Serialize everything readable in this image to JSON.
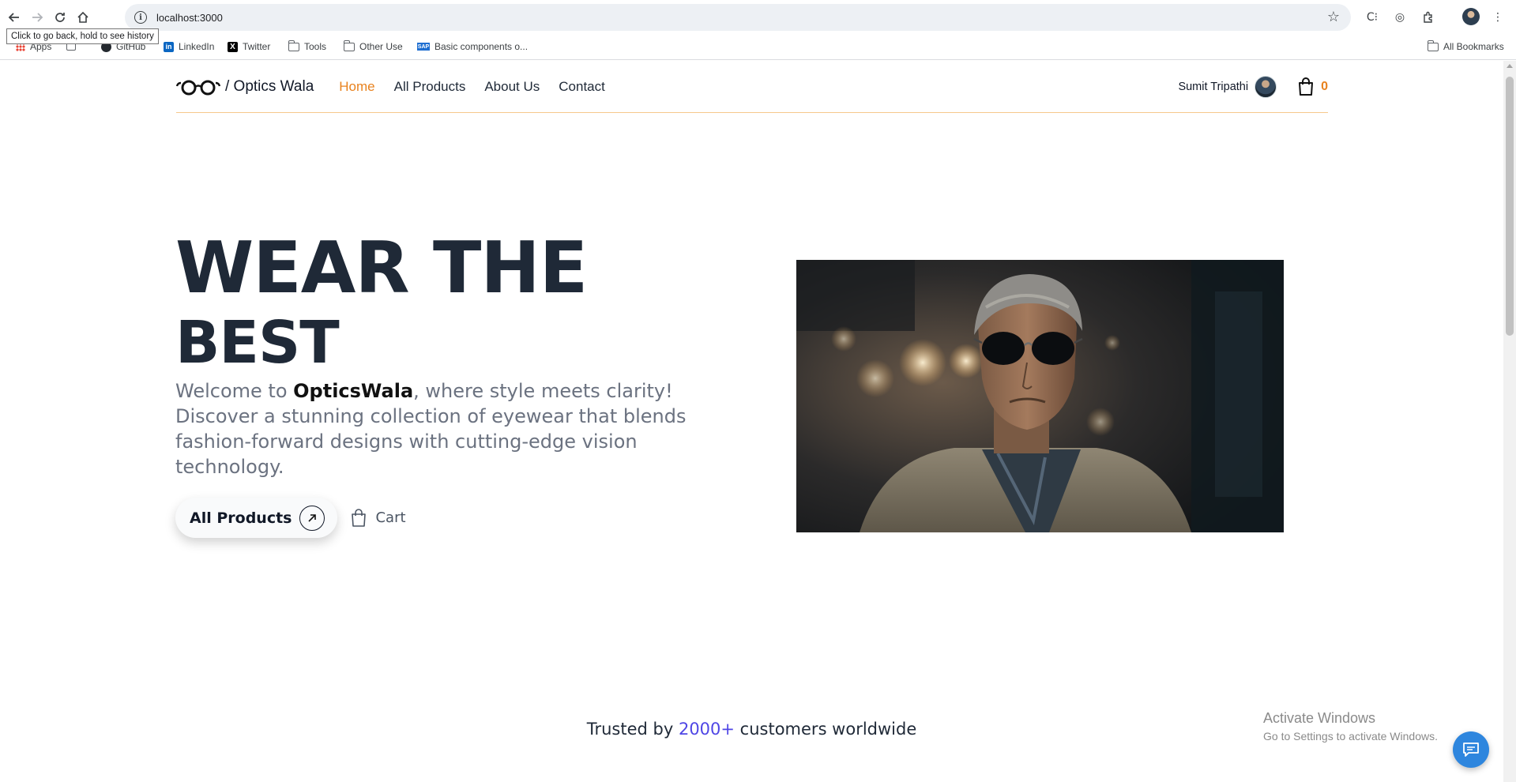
{
  "browser": {
    "url": "localhost:3000",
    "tooltip": "Click to go back, hold to see history",
    "bookmarks": [
      {
        "label": "Apps",
        "icon": "apps-grid-icon"
      },
      {
        "label": "",
        "icon": "tab-groups-icon"
      },
      {
        "label": "GitHub",
        "icon": "github-icon"
      },
      {
        "label": "LinkedIn",
        "icon": "linkedin-icon"
      },
      {
        "label": "Twitter",
        "icon": "x-twitter-icon"
      },
      {
        "label": "Tools",
        "icon": "folder-icon"
      },
      {
        "label": "Other Use",
        "icon": "folder-icon"
      },
      {
        "label": "Basic components o...",
        "icon": "sap-icon"
      }
    ],
    "all_bookmarks": "All Bookmarks"
  },
  "header": {
    "logo_text": "/ Optics Wala",
    "nav": [
      {
        "label": "Home",
        "active": true
      },
      {
        "label": "All Products",
        "active": false
      },
      {
        "label": "About Us",
        "active": false
      },
      {
        "label": "Contact",
        "active": false
      }
    ],
    "user_name": "Sumit Tripathi",
    "cart_count": "0"
  },
  "hero": {
    "title_line1": "WEAR THE",
    "title_line2": "BEST",
    "desc_before": "Welcome to ",
    "desc_brand": "OpticsWala",
    "desc_after": ", where style meets clarity! Discover a stunning collection of eyewear that blends fashion-forward designs with cutting-edge vision technology.",
    "btn_all_products": "All Products",
    "btn_cart": "Cart",
    "image_subject": "man-with-sunglasses-photo"
  },
  "trusted": {
    "before": "Trusted by ",
    "number": "2000+",
    "after": " customers worldwide"
  },
  "windows_watermark": {
    "line1": "Activate Windows",
    "line2": "Go to Settings to activate Windows."
  },
  "colors": {
    "accent": "#e8821e",
    "trusted_number": "#4f46e5",
    "chat_button": "#2e86de"
  }
}
